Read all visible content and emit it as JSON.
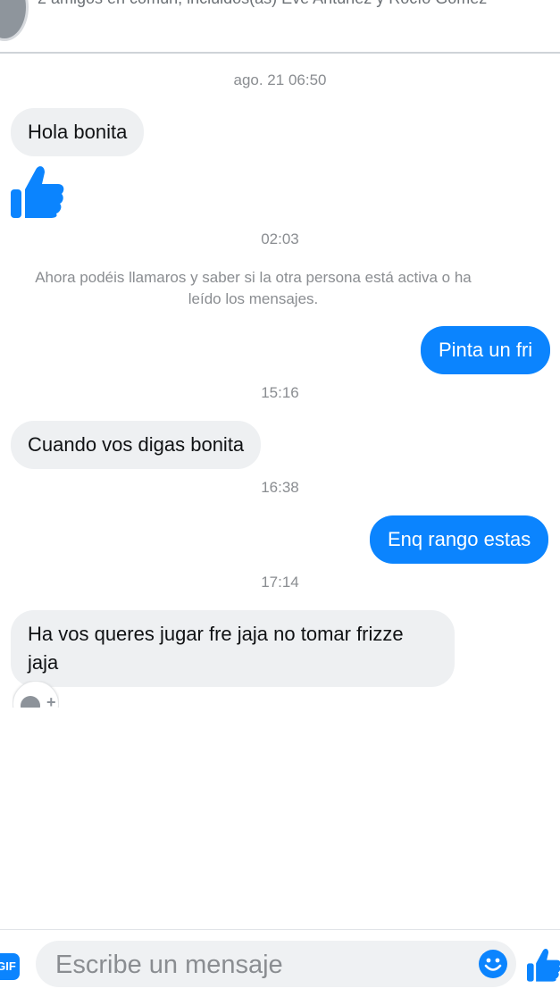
{
  "header": {
    "mutual_friends": "2 amigos en común, incluidos(as) Eve Antúnez y Rocío Gómez"
  },
  "conversation": {
    "ts1": "ago. 21 06:50",
    "msg1": "Hola bonita",
    "like_icon": "thumbs-up-icon",
    "ts2": "02:03",
    "notice": "Ahora podéis llamaros y saber si la otra persona está activa o ha leído los mensajes.",
    "msg2": "Pinta un fri",
    "ts3": "15:16",
    "msg3": "Cuando vos digas bonita",
    "ts4": "16:38",
    "msg4": "Enq rango estas",
    "ts5": "17:14",
    "msg5": "Ha vos queres jugar fre jaja no tomar frizze jaja"
  },
  "composer": {
    "gif_label": "GIF",
    "placeholder": "Escribe un mensaje",
    "emoji_icon": "smiley-icon",
    "send_icon": "thumbs-up-icon"
  },
  "colors": {
    "accent": "#0b84fe",
    "incoming_bubble": "#eef0f2",
    "timestamp": "#8a8d91"
  }
}
